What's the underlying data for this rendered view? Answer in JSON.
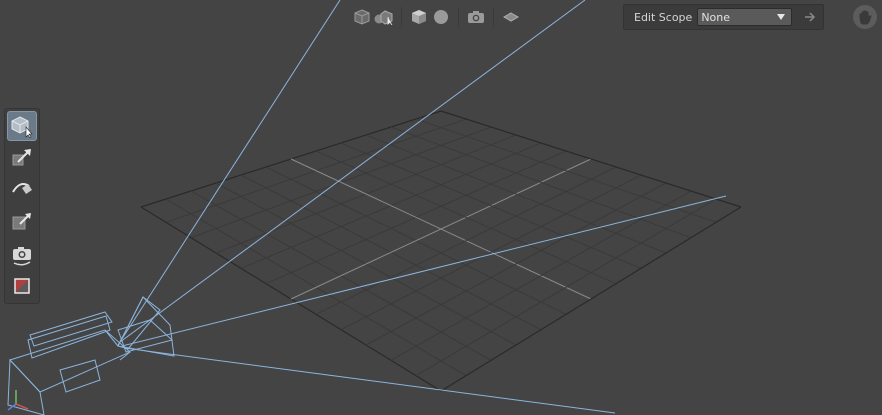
{
  "top_toolbar": {
    "icons": [
      "cube-icon",
      "spheres-icon",
      "cube-shaded-icon",
      "sphere-icon",
      "camera-icon",
      "layers-icon"
    ]
  },
  "edit_scope": {
    "label": "Edit Scope",
    "value": "None",
    "next_icon": "arrow-right-icon"
  },
  "hand_icon": "hand-icon",
  "left_toolbar": {
    "tools": [
      {
        "name": "select-tool",
        "icon": "cube-pointer-icon",
        "active": true
      },
      {
        "name": "translate-tool",
        "icon": "translate-arrow-icon",
        "active": false
      },
      {
        "name": "rotate-tool",
        "icon": "rotate-icon",
        "active": false
      },
      {
        "name": "scale-tool",
        "icon": "scale-arrow-icon",
        "active": false
      },
      {
        "name": "camera-tool",
        "icon": "camera-orbit-icon",
        "active": false
      },
      {
        "name": "crop-tool",
        "icon": "crop-icon",
        "active": false
      }
    ]
  },
  "colors": {
    "background": "#444444",
    "grid": "#3a3a3a",
    "grid_axis": "#8a8a8a",
    "camera_wire": "#8cb4dc",
    "active_tool": "#6b7a88"
  }
}
